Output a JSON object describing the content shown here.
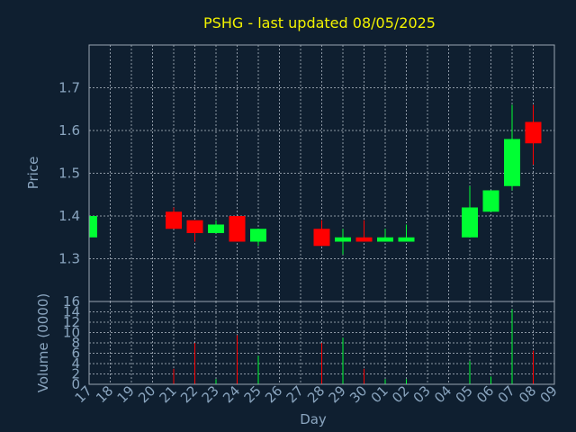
{
  "chart_data": {
    "type": "candlestick",
    "title": "PSHG - last updated 08/05/2025",
    "xlabel": "Day",
    "ylabel": "Price",
    "volume_ylabel": "Volume (0000)",
    "grid": true,
    "up_color": "#00ff33",
    "down_color": "#ff0000",
    "price_ylim": [
      1.2,
      1.8
    ],
    "price_ticks": [
      "1.3",
      "1.4",
      "1.5",
      "1.6",
      "1.7"
    ],
    "volume_ylim": [
      0,
      16
    ],
    "volume_ticks": [
      "0",
      "2",
      "4",
      "6",
      "8",
      "10",
      "12",
      "14",
      "16"
    ],
    "days": [
      "17",
      "18",
      "19",
      "20",
      "21",
      "22",
      "23",
      "24",
      "25",
      "26",
      "27",
      "28",
      "29",
      "30",
      "01",
      "02",
      "03",
      "04",
      "05",
      "06",
      "07",
      "08",
      "09"
    ],
    "candles": [
      {
        "day": "17",
        "open": 1.35,
        "high": 1.4,
        "low": 1.35,
        "close": 1.4,
        "volume": 0.0
      },
      {
        "day": "21",
        "open": 1.41,
        "high": 1.42,
        "low": 1.37,
        "close": 1.37,
        "volume": 3.0
      },
      {
        "day": "22",
        "open": 1.39,
        "high": 1.39,
        "low": 1.34,
        "close": 1.36,
        "volume": 8.0
      },
      {
        "day": "23",
        "open": 1.36,
        "high": 1.39,
        "low": 1.36,
        "close": 1.38,
        "volume": 1.0
      },
      {
        "day": "24",
        "open": 1.4,
        "high": 1.4,
        "low": 1.34,
        "close": 1.34,
        "volume": 9.5
      },
      {
        "day": "25",
        "open": 1.34,
        "high": 1.37,
        "low": 1.33,
        "close": 1.37,
        "volume": 5.5
      },
      {
        "day": "28",
        "open": 1.37,
        "high": 1.39,
        "low": 1.33,
        "close": 1.33,
        "volume": 8.0
      },
      {
        "day": "29",
        "open": 1.34,
        "high": 1.37,
        "low": 1.31,
        "close": 1.35,
        "volume": 9.0
      },
      {
        "day": "30",
        "open": 1.35,
        "high": 1.39,
        "low": 1.34,
        "close": 1.34,
        "volume": 3.0
      },
      {
        "day": "01",
        "open": 1.34,
        "high": 1.37,
        "low": 1.34,
        "close": 1.35,
        "volume": 1.0
      },
      {
        "day": "02",
        "open": 1.34,
        "high": 1.38,
        "low": 1.34,
        "close": 1.35,
        "volume": 1.0
      },
      {
        "day": "05",
        "open": 1.35,
        "high": 1.47,
        "low": 1.35,
        "close": 1.42,
        "volume": 4.5
      },
      {
        "day": "06",
        "open": 1.41,
        "high": 1.46,
        "low": 1.41,
        "close": 1.46,
        "volume": 1.5
      },
      {
        "day": "07",
        "open": 1.47,
        "high": 1.66,
        "low": 1.46,
        "close": 1.58,
        "volume": 14.5
      },
      {
        "day": "08",
        "open": 1.62,
        "high": 1.66,
        "low": 1.52,
        "close": 1.57,
        "volume": 6.5
      }
    ]
  }
}
